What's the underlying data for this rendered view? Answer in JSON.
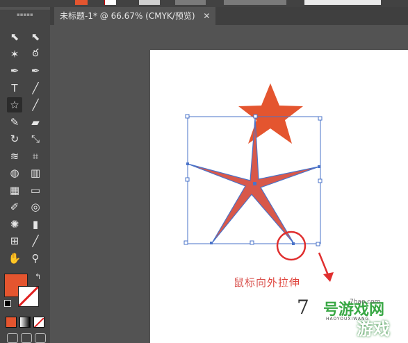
{
  "document_tab": {
    "title": "未标题-1* @ 66.67% (CMYK/预览)",
    "close_glyph": "✕"
  },
  "top_bar": {
    "fill_color": "#e4552f",
    "stroke_color": "#ffffff"
  },
  "tools": [
    {
      "name": "selection-tool",
      "glyph": "⬉"
    },
    {
      "name": "direct-selection-tool",
      "glyph": "⬉"
    },
    {
      "name": "magic-wand-tool",
      "glyph": "✶"
    },
    {
      "name": "lasso-tool",
      "glyph": "ఠ"
    },
    {
      "name": "pen-tool",
      "glyph": "✒"
    },
    {
      "name": "curvature-tool",
      "glyph": "✒"
    },
    {
      "name": "type-tool",
      "glyph": "T"
    },
    {
      "name": "line-segment-tool",
      "glyph": "╱"
    },
    {
      "name": "star-tool",
      "glyph": "☆"
    },
    {
      "name": "paintbrush-tool",
      "glyph": "╱"
    },
    {
      "name": "pencil-tool",
      "glyph": "✎"
    },
    {
      "name": "eraser-tool",
      "glyph": "▰"
    },
    {
      "name": "rotate-tool",
      "glyph": "↻"
    },
    {
      "name": "scale-tool",
      "glyph": "⤡"
    },
    {
      "name": "warp-tool",
      "glyph": "≋"
    },
    {
      "name": "free-transform-tool",
      "glyph": "⌗"
    },
    {
      "name": "shape-builder-tool",
      "glyph": "◍"
    },
    {
      "name": "perspective-grid-tool",
      "glyph": "▥"
    },
    {
      "name": "mesh-tool",
      "glyph": "▦"
    },
    {
      "name": "gradient-tool",
      "glyph": "▭"
    },
    {
      "name": "eyedropper-tool",
      "glyph": "✐"
    },
    {
      "name": "blend-tool",
      "glyph": "◎"
    },
    {
      "name": "symbol-sprayer-tool",
      "glyph": "✺"
    },
    {
      "name": "column-graph-tool",
      "glyph": "▮"
    },
    {
      "name": "artboard-tool",
      "glyph": "⊞"
    },
    {
      "name": "slice-tool",
      "glyph": "╱"
    },
    {
      "name": "hand-tool",
      "glyph": "✋"
    },
    {
      "name": "zoom-tool",
      "glyph": "⚲"
    }
  ],
  "colors": {
    "fill": "#e4552f",
    "stroke": "#ffffff",
    "selection_blue": "#4a73c9",
    "highlight_red": "#e02f2f"
  },
  "annotation": {
    "part1": "鼠标向",
    "part2": "外拉伸"
  },
  "watermark": {
    "number": "7",
    "line1": "号游戏网",
    "line2": "游戏",
    "site": "7hao.com",
    "pinyin": "HAOYOUXIWANG"
  }
}
